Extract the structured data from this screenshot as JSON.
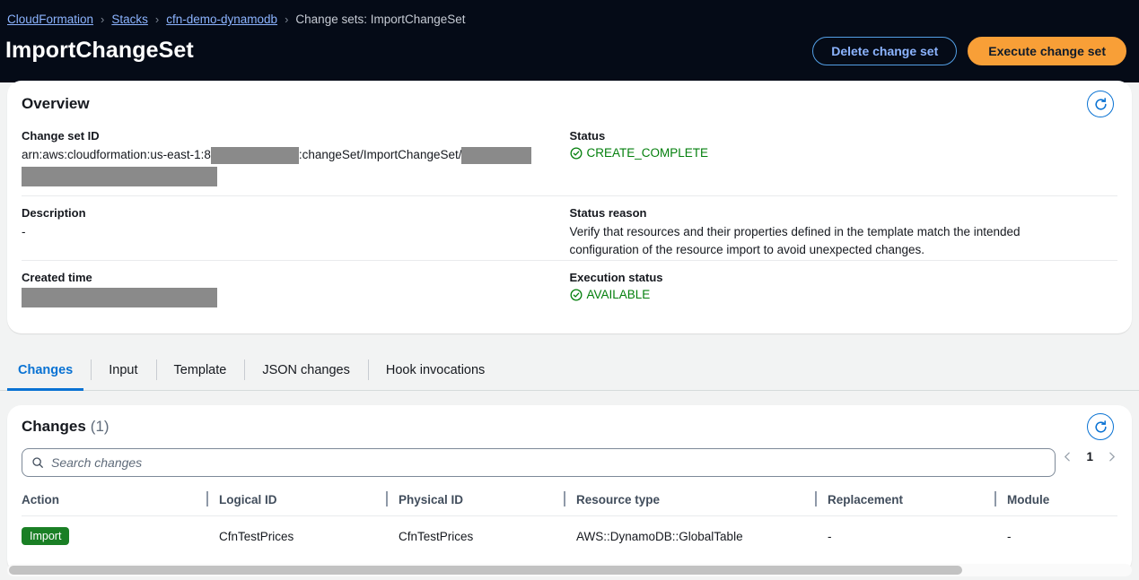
{
  "breadcrumb": {
    "items": [
      {
        "label": "CloudFormation",
        "link": true
      },
      {
        "label": "Stacks",
        "link": true
      },
      {
        "label": "cfn-demo-dynamodb",
        "link": true
      },
      {
        "label": "Change sets: ImportChangeSet",
        "link": false
      }
    ],
    "separator": "›"
  },
  "header": {
    "title": "ImportChangeSet",
    "delete_button": "Delete change set",
    "execute_button": "Execute change set"
  },
  "overview": {
    "title": "Overview",
    "change_set_id_label": "Change set ID",
    "change_set_id_prefix": "arn:aws:cloudformation:us-east-1:8",
    "change_set_id_middle": ":changeSet/ImportChangeSet/",
    "status_label": "Status",
    "status_value": "CREATE_COMPLETE",
    "description_label": "Description",
    "description_value": "-",
    "status_reason_label": "Status reason",
    "status_reason_value": "Verify that resources and their properties defined in the template match the intended configuration of the resource import to avoid unexpected changes.",
    "created_time_label": "Created time",
    "execution_status_label": "Execution status",
    "execution_status_value": "AVAILABLE"
  },
  "tabs": [
    {
      "label": "Changes",
      "active": true
    },
    {
      "label": "Input",
      "active": false
    },
    {
      "label": "Template",
      "active": false
    },
    {
      "label": "JSON changes",
      "active": false
    },
    {
      "label": "Hook invocations",
      "active": false
    }
  ],
  "changes": {
    "title": "Changes",
    "count": "(1)",
    "search_placeholder": "Search changes",
    "page_number": "1",
    "columns": [
      "Action",
      "Logical ID",
      "Physical ID",
      "Resource type",
      "Replacement",
      "Module"
    ],
    "rows": [
      {
        "action": "Import",
        "logical_id": "CfnTestPrices",
        "physical_id": "CfnTestPrices",
        "resource_type": "AWS::DynamoDB::GlobalTable",
        "replacement": "-",
        "module": "-"
      }
    ]
  },
  "colors": {
    "header_bg": "#050b17",
    "accent_blue": "#0972d3",
    "link_blue": "#8cb4ff",
    "primary_orange": "#f89f37",
    "status_green": "#037f0c",
    "badge_green": "#1a7f25"
  }
}
